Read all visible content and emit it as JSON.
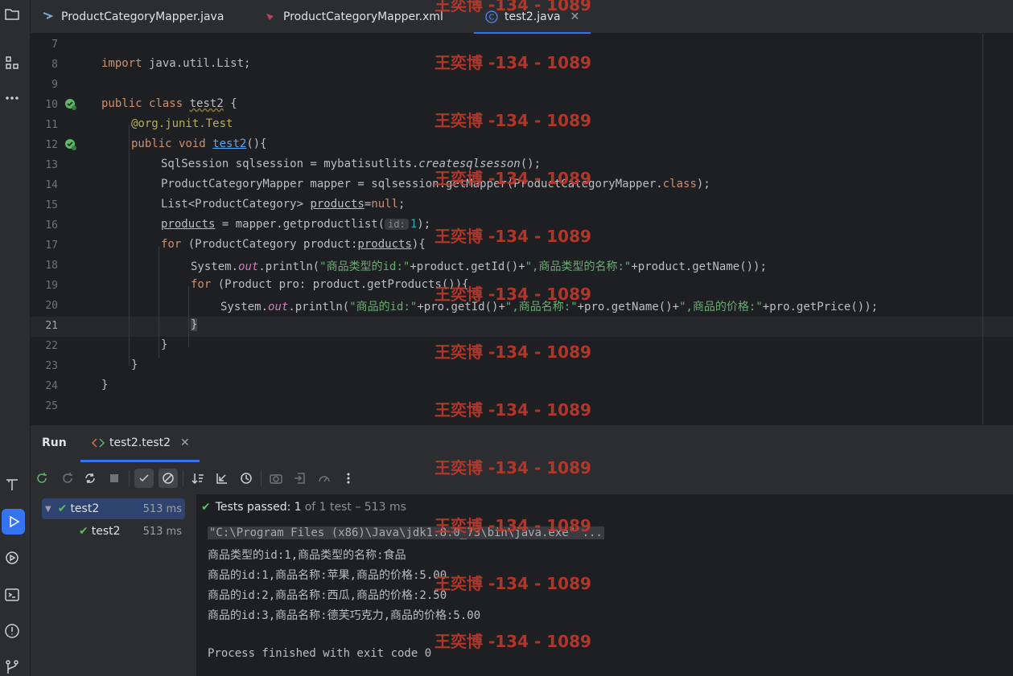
{
  "tabs": [
    {
      "label": "ProductCategoryMapper.java",
      "icon": "java-class-icon"
    },
    {
      "label": "ProductCategoryMapper.xml",
      "icon": "xml-file-icon"
    },
    {
      "label": "test2.java",
      "icon": "class-c-icon",
      "active": true
    }
  ],
  "editor": {
    "line_numbers": [
      "7",
      "8",
      "9",
      "10",
      "11",
      "12",
      "13",
      "14",
      "15",
      "16",
      "17",
      "18",
      "19",
      "20",
      "21",
      "22",
      "23",
      "24",
      "25"
    ],
    "current_line": "21"
  },
  "code": {
    "l8_kw": "import",
    "l8_rest": " java.util.List;",
    "l10_kw1": "public",
    "l10_kw2": "class",
    "l10_name": "test2",
    "l10_end": " {",
    "l11_ann": "@org.junit.Test",
    "l12_kw1": "public",
    "l12_kw2": "void",
    "l12_name": "test2",
    "l12_end": "(){",
    "l13_a": "SqlSession sqlsession = mybatisutlits.",
    "l13_m": "createsqlsesson",
    "l13_b": "();",
    "l14_a": "ProductCategoryMapper mapper = sqlsession.getMapper(ProductCategoryMapper.",
    "l14_kw": "class",
    "l14_b": ");",
    "l15_a": "List<ProductCategory> ",
    "l15_var": "products",
    "l15_b": "=",
    "l15_kw": "null",
    "l15_c": ";",
    "l16_var": "products",
    "l16_a": " = mapper.getproductlist(",
    "l16_hint": "id:",
    "l16_num": "1",
    "l16_b": ");",
    "l17_kw": "for",
    "l17_a": " (ProductCategory product:",
    "l17_var": "products",
    "l17_b": "){",
    "l18_a": "System.",
    "l18_out": "out",
    "l18_b": ".println(",
    "l18_s1": "\"商品类型的id:\"",
    "l18_c": "+product.getId()+",
    "l18_s2": "\",商品类型的名称:\"",
    "l18_d": "+product.getName());",
    "l19_kw": "for",
    "l19_a": " (Product pro: product.getProducts()){",
    "l20_a": "System.",
    "l20_out": "out",
    "l20_b": ".println(",
    "l20_s1": "\"商品的id:\"",
    "l20_c": "+pro.getId()+",
    "l20_s2": "\",商品名称:\"",
    "l20_d": "+pro.getName()+",
    "l20_s3": "\",商品的价格:\"",
    "l20_e": "+pro.getPrice());",
    "l21": "}",
    "l22": "}",
    "l23": "}",
    "l24": "}"
  },
  "run_panel": {
    "title": "Run",
    "tab_label": "test2.test2",
    "tree": [
      {
        "label": "test2",
        "time": "513 ms"
      },
      {
        "label": "test2",
        "time": "513 ms"
      }
    ],
    "status_main": "Tests passed: 1",
    "status_detail": "of 1 test – 513 ms",
    "console": [
      "\"C:\\Program Files (x86)\\Java\\jdk1.8.0_73\\bin\\java.exe\" ...",
      "商品类型的id:1,商品类型的名称:食品",
      "商品的id:1,商品名称:苹果,商品的价格:5.00",
      "商品的id:2,商品名称:西瓜,商品的价格:2.50",
      "商品的id:3,商品名称:德芙巧克力,商品的价格:5.00",
      "",
      "Process finished with exit code 0"
    ]
  },
  "watermark": "王奕博 -134 - 1089",
  "colors": {
    "accent": "#3574f0",
    "pass": "#5fb865",
    "watermark": "#c0392b"
  }
}
